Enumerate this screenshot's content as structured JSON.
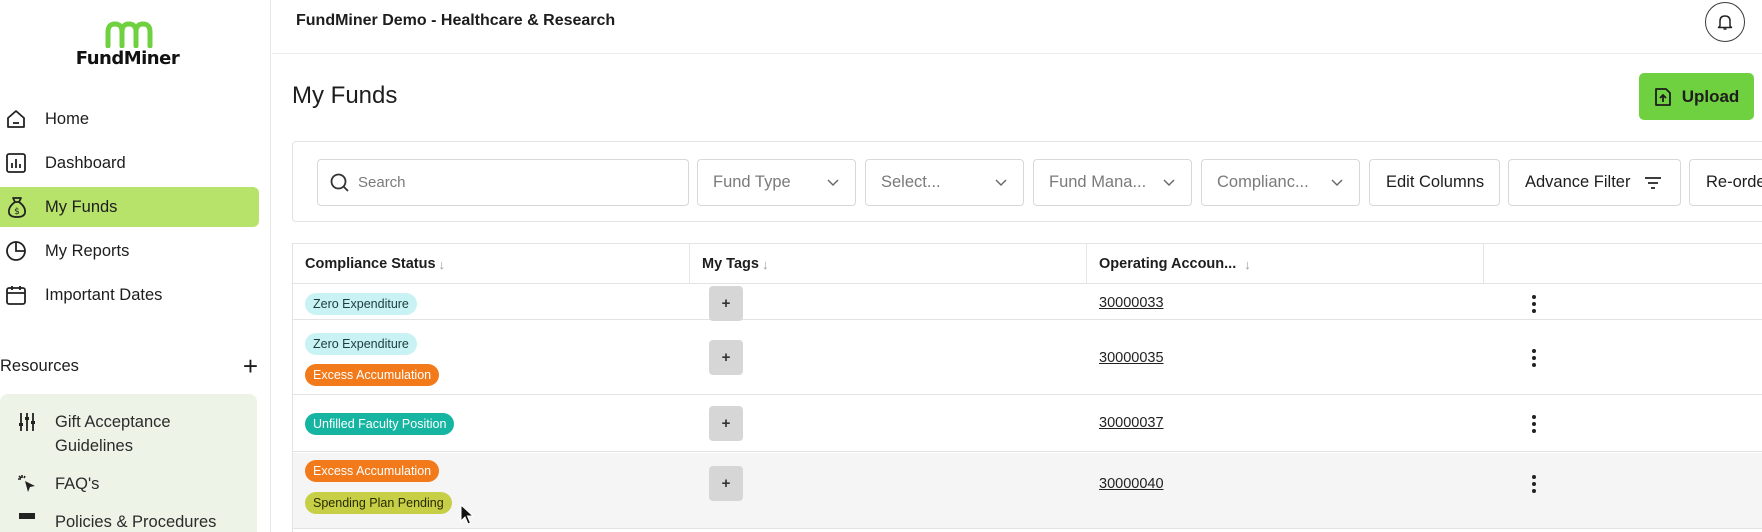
{
  "logo": {
    "text": "FundMiner"
  },
  "sidebar": {
    "items": [
      {
        "label": "Home",
        "icon": "home-icon"
      },
      {
        "label": "Dashboard",
        "icon": "bar-chart-icon"
      },
      {
        "label": "My Funds",
        "icon": "money-bag-icon",
        "active": true
      },
      {
        "label": "My Reports",
        "icon": "pie-chart-icon"
      },
      {
        "label": "Important Dates",
        "icon": "calendar-icon"
      }
    ],
    "resources_title": "Resources",
    "resources_add": "+",
    "resources": [
      {
        "label": "Gift Acceptance Guidelines",
        "line1": "Gift Acceptance",
        "line2": "Guidelines",
        "icon": "sliders-icon"
      },
      {
        "label": "FAQ's",
        "icon": "cursor-click-icon"
      },
      {
        "label": "Policies & Procedures",
        "icon": "document-icon"
      }
    ]
  },
  "header": {
    "org_title": "FundMiner Demo - Healthcare & Research",
    "bell_icon": "bell-icon"
  },
  "main": {
    "title": "My Funds",
    "upload_label": "Upload"
  },
  "filters": {
    "search_placeholder": "Search",
    "fund_type": "Fund Type",
    "select": "Select...",
    "fund_manager": "Fund Mana...",
    "compliance": "Complianc...",
    "edit_columns": "Edit Columns",
    "advance_filter": "Advance Filter",
    "reorder": "Re-orde"
  },
  "table": {
    "headers": [
      "Compliance Status",
      "My Tags",
      "Operating Accoun..."
    ],
    "sort_glyph": "↓",
    "add_tag": "+",
    "rows": [
      {
        "tags": [
          {
            "text": "Zero Expenditure",
            "color": "cyan"
          }
        ],
        "account": "30000033"
      },
      {
        "tags": [
          {
            "text": "Zero Expenditure",
            "color": "cyan"
          },
          {
            "text": "Excess Accumulation",
            "color": "orange"
          }
        ],
        "account": "30000035"
      },
      {
        "tags": [
          {
            "text": "Unfilled Faculty Position",
            "color": "teal"
          }
        ],
        "account": "30000037"
      },
      {
        "tags": [
          {
            "text": "Excess Accumulation",
            "color": "orange"
          },
          {
            "text": "Spending Plan Pending",
            "color": "olive"
          }
        ],
        "account": "30000040"
      }
    ]
  },
  "colors": {
    "accent": "#6fd13f",
    "active_nav": "#b8e36a",
    "resources_bg": "#edf3e6"
  }
}
